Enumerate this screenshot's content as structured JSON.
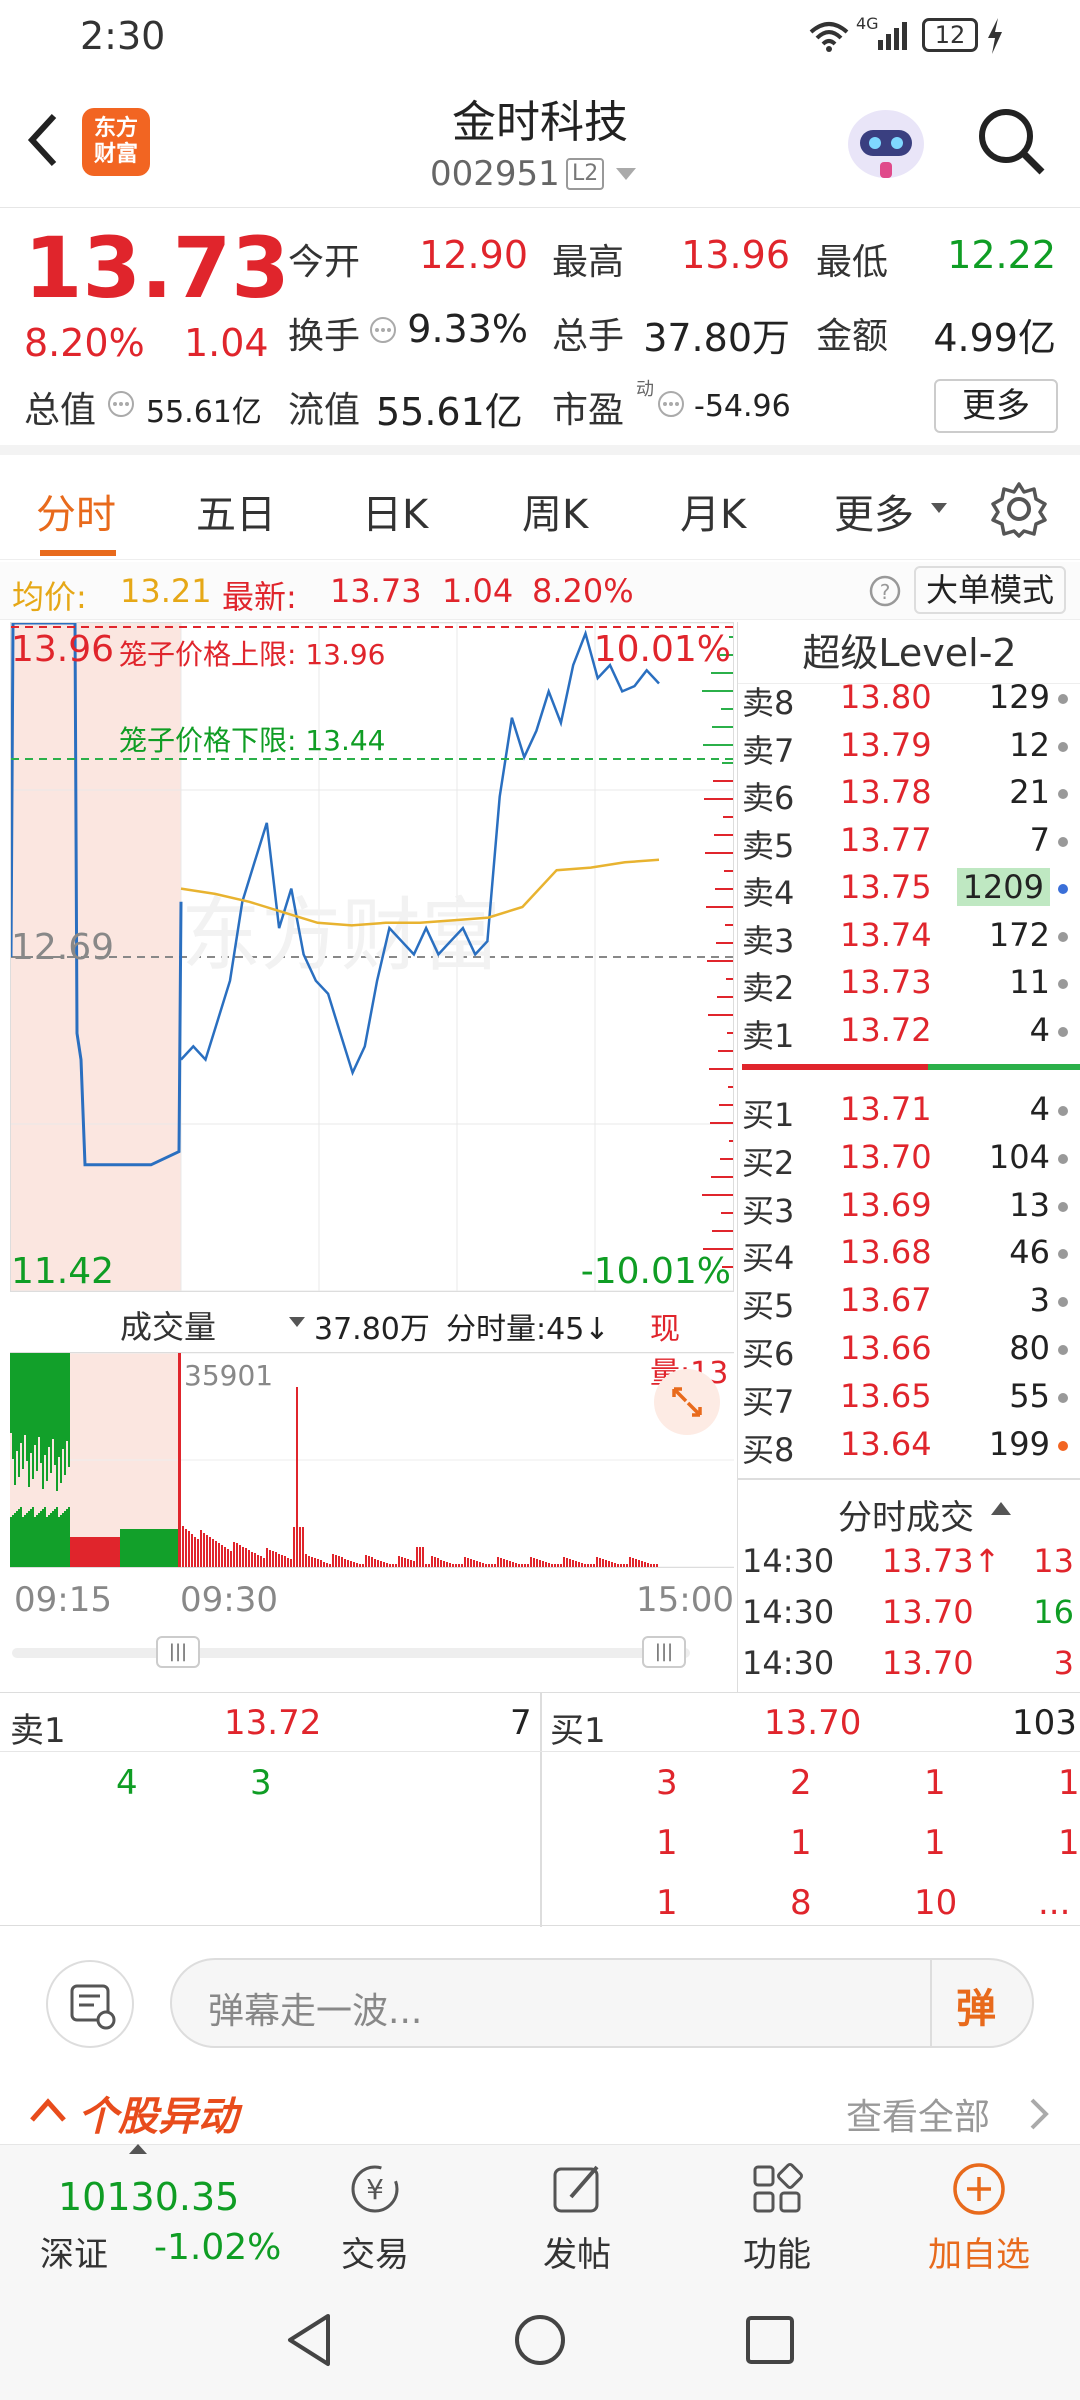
{
  "status_bar": {
    "time": "2:30",
    "network": "4G",
    "battery": "12"
  },
  "header": {
    "logo_line1": "东方",
    "logo_line2": "财富",
    "title": "金时科技",
    "code": "002951",
    "level_badge": "L2"
  },
  "quote": {
    "price": "13.73",
    "change_pct": "8.20%",
    "change": "1.04",
    "open_label": "今开",
    "open": "12.90",
    "high_label": "最高",
    "high": "13.96",
    "low_label": "最低",
    "low": "12.22",
    "turnover_label": "换手",
    "turnover": "9.33%",
    "volume_label": "总手",
    "volume": "37.80万",
    "amount_label": "金额",
    "amount": "4.99亿",
    "mktcap_label": "总值",
    "mktcap": "55.61亿",
    "float_label": "流值",
    "float": "55.61亿",
    "pe_label": "市盈",
    "pe_sup": "动",
    "pe": "-54.96",
    "more_label": "更多"
  },
  "tabs": [
    "分时",
    "五日",
    "日K",
    "周K",
    "月K",
    "更多"
  ],
  "infobar": {
    "avg_label": "均价:",
    "avg": "13.21",
    "last_label": "最新:",
    "last": "13.73",
    "chg": "1.04",
    "pct": "8.20%",
    "mode": "大单模式"
  },
  "chart": {
    "top_price": "13.96",
    "mid_price": "12.69",
    "bottom_price": "11.42",
    "top_pct": "10.01%",
    "bottom_pct": "-10.01%",
    "cage_upper": "笼子价格上限: 13.96",
    "cage_lower": "笼子价格下限: 13.44",
    "watermark": "东方财富"
  },
  "chart_data": {
    "type": "line",
    "ylim": [
      11.42,
      13.96
    ],
    "prev_close": 12.69,
    "series": [
      {
        "values": [
          12.3,
          12.35,
          12.3,
          12.45,
          12.6,
          12.9,
          13.05,
          13.2,
          12.8,
          12.95,
          12.7,
          12.6,
          12.55,
          12.4,
          12.25,
          12.35,
          12.6,
          12.8,
          12.75,
          12.7,
          12.8,
          12.7,
          12.75,
          12.8,
          12.7,
          12.75,
          13.3,
          13.6,
          13.45,
          13.55,
          13.7,
          13.58,
          13.8,
          13.92,
          13.75,
          13.8,
          13.7,
          13.72,
          13.78,
          13.73
        ]
      },
      {
        "values": [
          12.95,
          12.93,
          12.9,
          12.86,
          12.82,
          12.81,
          12.82,
          12.82,
          12.83,
          12.84,
          12.88,
          13.02,
          13.03,
          13.05,
          13.06
        ]
      }
    ]
  },
  "level2": {
    "title": "超级Level-2",
    "asks": [
      {
        "label": "卖8",
        "price": "13.80",
        "vol": "129"
      },
      {
        "label": "卖7",
        "price": "13.79",
        "vol": "12"
      },
      {
        "label": "卖6",
        "price": "13.78",
        "vol": "21"
      },
      {
        "label": "卖5",
        "price": "13.77",
        "vol": "7"
      },
      {
        "label": "卖4",
        "price": "13.75",
        "vol": "1209"
      },
      {
        "label": "卖3",
        "price": "13.74",
        "vol": "172"
      },
      {
        "label": "卖2",
        "price": "13.73",
        "vol": "11"
      },
      {
        "label": "卖1",
        "price": "13.72",
        "vol": "4"
      }
    ],
    "bids": [
      {
        "label": "买1",
        "price": "13.71",
        "vol": "4"
      },
      {
        "label": "买2",
        "price": "13.70",
        "vol": "104"
      },
      {
        "label": "买3",
        "price": "13.69",
        "vol": "13"
      },
      {
        "label": "买4",
        "price": "13.68",
        "vol": "46"
      },
      {
        "label": "买5",
        "price": "13.67",
        "vol": "3"
      },
      {
        "label": "买6",
        "price": "13.66",
        "vol": "80"
      },
      {
        "label": "买7",
        "price": "13.65",
        "vol": "55"
      },
      {
        "label": "买8",
        "price": "13.64",
        "vol": "199"
      }
    ],
    "ticks_title": "分时成交",
    "ticks": [
      {
        "time": "14:30",
        "price": "13.73↑",
        "vol": "13"
      },
      {
        "time": "14:30",
        "price": "13.70",
        "vol": "16"
      },
      {
        "time": "14:30",
        "price": "13.70",
        "vol": "3"
      }
    ]
  },
  "volume": {
    "label": "成交量",
    "total": "37.80万",
    "fenshi": "分时量:45↓",
    "xianliang": "现量:13",
    "max": "35901"
  },
  "times": [
    "09:15",
    "09:30",
    "15:00"
  ],
  "fb": {
    "sell_label": "卖1",
    "sell_price": "13.72",
    "sell_vol": "7",
    "buy_label": "买1",
    "buy_price": "13.70",
    "buy_vol": "103",
    "sell_rows": [
      [
        "4",
        "3"
      ]
    ],
    "buy_rows": [
      [
        "3",
        "2",
        "1",
        "1"
      ],
      [
        "1",
        "1",
        "1",
        "1"
      ],
      [
        "1",
        "8",
        "10",
        "..."
      ]
    ]
  },
  "danmu": {
    "placeholder": "弹幕走一波...",
    "send": "弹"
  },
  "yidong": {
    "title": "个股异动",
    "view_all": "查看全部"
  },
  "bottom": {
    "index_value": "10130.35",
    "index_name": "深证",
    "index_pct": "-1.02%",
    "items": [
      "交易",
      "发帖",
      "功能",
      "加自选"
    ]
  },
  "colors": {
    "red": "#e0252c",
    "green": "#0f9d24",
    "orange": "#f26522",
    "avg_line": "#e8b330",
    "price_line": "#2a6fc0"
  }
}
